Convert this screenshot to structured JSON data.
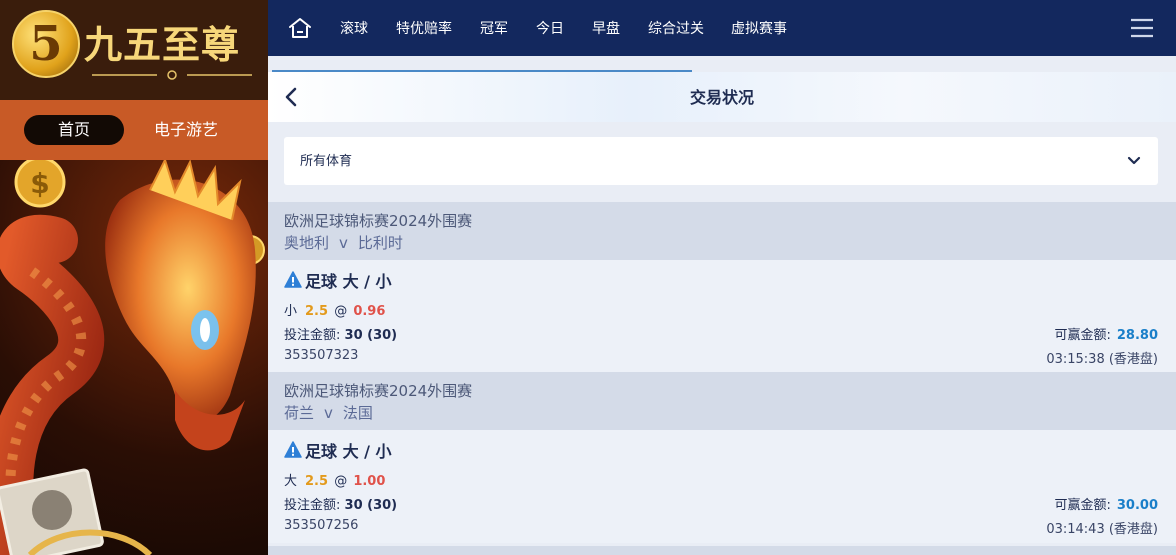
{
  "brand": {
    "name": "九五至尊",
    "badge": "5"
  },
  "side_nav": {
    "home": "首页",
    "games": "电子游艺"
  },
  "top_nav": {
    "icons": {
      "home": "home-icon",
      "menu": "hamburger-menu-icon"
    },
    "items": [
      "滚球",
      "特优赔率",
      "冠军",
      "今日",
      "早盘",
      "综合过关",
      "虚拟赛事"
    ]
  },
  "header": {
    "title": "交易状况"
  },
  "filter": {
    "selected": "所有体育"
  },
  "colors": {
    "nav_bg": "#13285e",
    "accent_orange": "#c85a26",
    "odds_red": "#e0524a",
    "handicap_orange": "#e39a1c",
    "win_blue": "#1a7fc9"
  },
  "bets": [
    {
      "league": "欧洲足球锦标赛2024外围赛",
      "home": "奥地利",
      "vs": "v",
      "away": "比利时",
      "title": "足球 大 / 小",
      "selection": "小",
      "handicap": "2.5",
      "at": "@",
      "odds": "0.96",
      "stake_label": "投注金额:",
      "stake": "30 (30)",
      "win_label": "可赢金额:",
      "win": "28.80",
      "id": "353507323",
      "time": "03:15:38 (香港盘)"
    },
    {
      "league": "欧洲足球锦标赛2024外围赛",
      "home": "荷兰",
      "vs": "v",
      "away": "法国",
      "title": "足球 大 / 小",
      "selection": "大",
      "handicap": "2.5",
      "at": "@",
      "odds": "1.00",
      "stake_label": "投注金额:",
      "stake": "30 (30)",
      "win_label": "可赢金额:",
      "win": "30.00",
      "id": "353507256",
      "time": "03:14:43 (香港盘)"
    }
  ]
}
